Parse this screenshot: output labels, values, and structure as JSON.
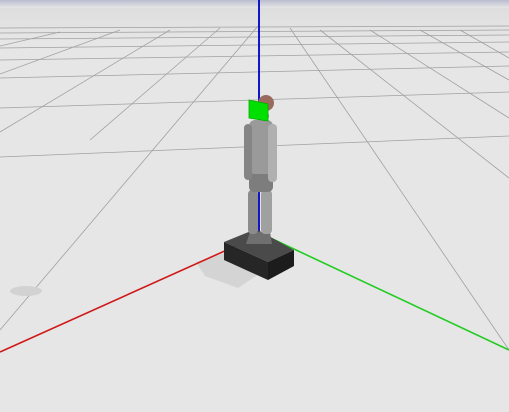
{
  "colors": {
    "sky": "#b9bccf",
    "ground": "#e6e6e6",
    "grid": "#8a8a8a",
    "axis_x": "#d01818",
    "axis_y": "#22cc22",
    "axis_z": "#1414c8",
    "marker": "#00e000",
    "robot_body": "#8f8f8f",
    "robot_head": "#9a6a5e",
    "base": "#333333",
    "shadow": "#cfcfcf"
  },
  "scene": {
    "objects": [
      {
        "name": "ground-plane",
        "kind": "ground"
      },
      {
        "name": "reference-grid",
        "kind": "grid"
      },
      {
        "name": "x-axis",
        "kind": "axis",
        "color_key": "axis_x"
      },
      {
        "name": "y-axis",
        "kind": "axis",
        "color_key": "axis_y"
      },
      {
        "name": "z-axis",
        "kind": "axis",
        "color_key": "axis_z"
      },
      {
        "name": "robot-base",
        "kind": "model"
      },
      {
        "name": "humanoid-robot",
        "kind": "model"
      },
      {
        "name": "green-marker",
        "kind": "marker",
        "color_key": "marker"
      }
    ]
  }
}
